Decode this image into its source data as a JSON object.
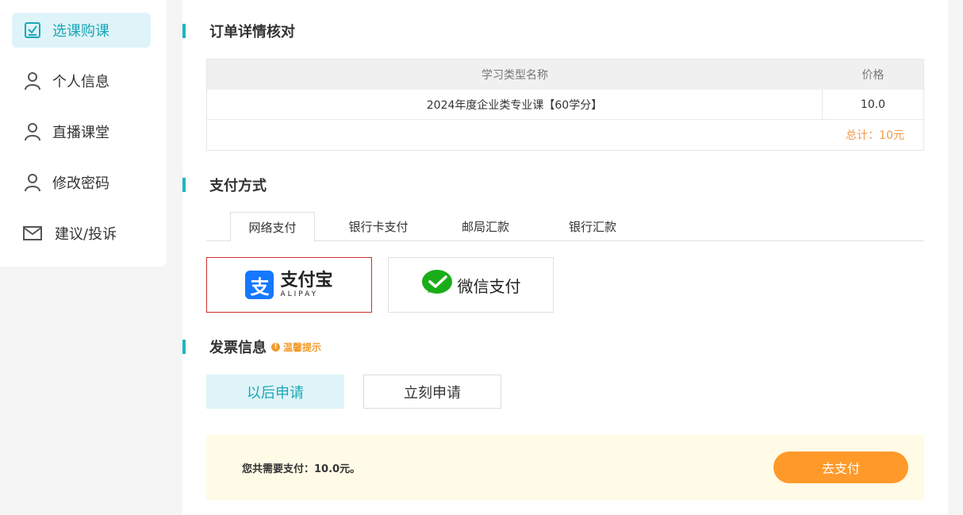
{
  "sidebar": {
    "items": [
      {
        "label": "选课购课",
        "icon": "checkbox-icon",
        "active": true
      },
      {
        "label": "个人信息",
        "icon": "user-icon"
      },
      {
        "label": "直播课堂",
        "icon": "user-icon"
      },
      {
        "label": "修改密码",
        "icon": "user-icon"
      },
      {
        "label": "建议/投诉",
        "icon": "mail-icon"
      }
    ]
  },
  "order": {
    "title": "订单详情核对",
    "columns": [
      "学习类型名称",
      "价格"
    ],
    "rows": [
      {
        "name": "2024年度企业类专业课【60学分】",
        "price": "10.0"
      }
    ],
    "total": "总计：10元"
  },
  "payment": {
    "title": "支付方式",
    "tabs": [
      "网络支付",
      "银行卡支付",
      "邮局汇款",
      "银行汇款"
    ],
    "active_tab": 0,
    "alipay": {
      "cn": "支付宝",
      "en": "ALIPAY",
      "mark": "支"
    },
    "wechat": {
      "label": "微信支付"
    }
  },
  "invoice": {
    "title": "发票信息",
    "hint": "温馨提示",
    "hint_icon": "!",
    "later_label": "以后申请",
    "now_label": "立刻申请"
  },
  "pay_bar": {
    "summary": "您共需要支付：10.0元。",
    "button": "去支付"
  },
  "colors": {
    "accent": "#1fb5c2",
    "active_bg": "#dff4f8",
    "orange": "#ff9a2a",
    "selected_border": "#c9302c",
    "alipay_blue": "#1677ff",
    "wechat_green": "#1aad19"
  }
}
